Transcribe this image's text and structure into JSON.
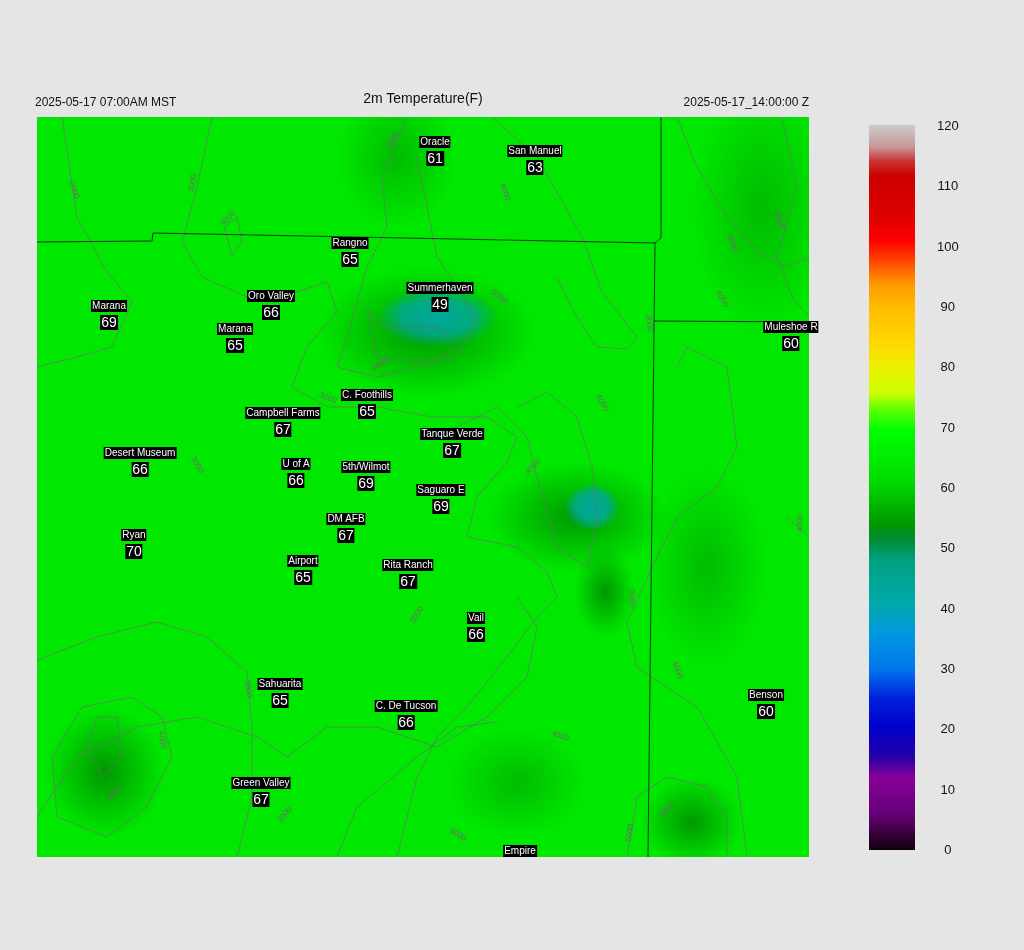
{
  "header": {
    "local_time": "2025-05-17 07:00AM MST",
    "title": "2m Temperature(F)",
    "valid_time": "2025-05-17_14:00:00 Z"
  },
  "map": {
    "stations": [
      {
        "name": "Oracle",
        "value": "61"
      },
      {
        "name": "San Manuel",
        "value": "63"
      },
      {
        "name": "Rangno",
        "value": "65"
      },
      {
        "name": "Summerhaven",
        "value": "49"
      },
      {
        "name": "Marana",
        "value": "69"
      },
      {
        "name": "Oro Valley",
        "value": "66"
      },
      {
        "name": "Marana",
        "value": "65"
      },
      {
        "name": "Muleshoe R",
        "value": "60"
      },
      {
        "name": "C. Foothills",
        "value": "65"
      },
      {
        "name": "Campbell Farms",
        "value": "67"
      },
      {
        "name": "Tanque Verde",
        "value": "67"
      },
      {
        "name": "Desert Museum",
        "value": "66"
      },
      {
        "name": "U of A",
        "value": "66"
      },
      {
        "name": "5th/Wilmot",
        "value": "69"
      },
      {
        "name": "Saguaro E",
        "value": "69"
      },
      {
        "name": "DM AFB",
        "value": "67"
      },
      {
        "name": "Ryan",
        "value": "70"
      },
      {
        "name": "Airport",
        "value": "65"
      },
      {
        "name": "Rita Ranch",
        "value": "67"
      },
      {
        "name": "Vail",
        "value": "66"
      },
      {
        "name": "Sahuarita",
        "value": "65"
      },
      {
        "name": "C. De Tucson",
        "value": "66"
      },
      {
        "name": "Benson",
        "value": "60"
      },
      {
        "name": "Green Valley",
        "value": "67"
      },
      {
        "name": "Empire"
      }
    ],
    "contour_labels": [
      "2000",
      "3000",
      "4000",
      "4000",
      "6000",
      "3000",
      "3000",
      "4000",
      "6000",
      "5000",
      "5000",
      "4000",
      "3000",
      "4000",
      "4000",
      "3000",
      "4000",
      "5000",
      "3000",
      "3000",
      "5000",
      "4000",
      "4000",
      "4000",
      "5000",
      "5000",
      "6000"
    ]
  },
  "colorbar": {
    "ticks": [
      "120",
      "110",
      "100",
      "90",
      "80",
      "70",
      "60",
      "50",
      "40",
      "30",
      "20",
      "10",
      "0"
    ]
  }
}
